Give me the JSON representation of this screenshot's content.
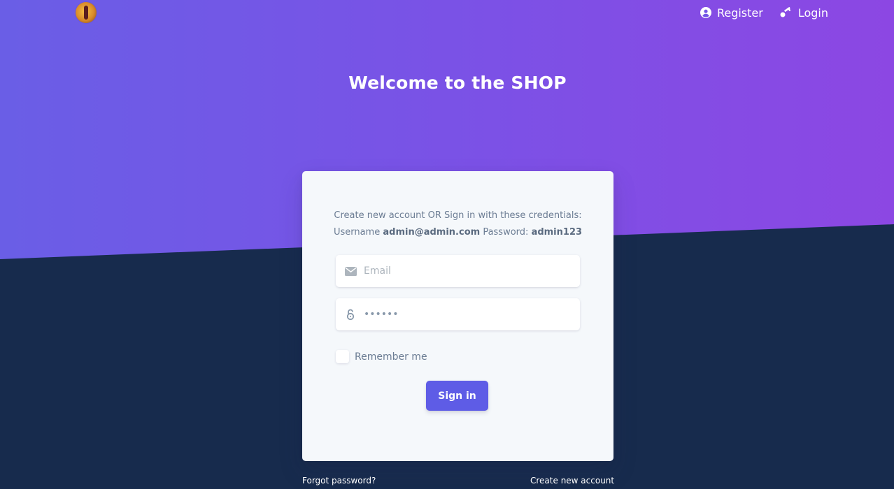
{
  "nav": {
    "register_label": "Register",
    "login_label": "Login"
  },
  "hero": {
    "title": "Welcome to the SHOP"
  },
  "login_card": {
    "intro_text": "Create new account OR Sign in with these credentials:",
    "username_label": "Username",
    "username_value": "admin@admin.com",
    "password_label": "Password:",
    "password_value": "admin123",
    "email_placeholder": "Email",
    "password_mask": "••••••",
    "remember_label": "Remember me",
    "signin_label": "Sign in"
  },
  "footer_links": {
    "forgot_password": "Forgot password?",
    "create_account": "Create new account"
  },
  "colors": {
    "hero_gradient_start": "#6a5ee6",
    "hero_gradient_end": "#8c47e3",
    "background_dark": "#172b4d",
    "primary_button": "#5e5ce6",
    "card_background": "#f5f8fb"
  },
  "icons": {
    "register": "user-circle-icon",
    "login": "key-icon",
    "email": "envelope-icon",
    "password": "lock-open-icon"
  }
}
